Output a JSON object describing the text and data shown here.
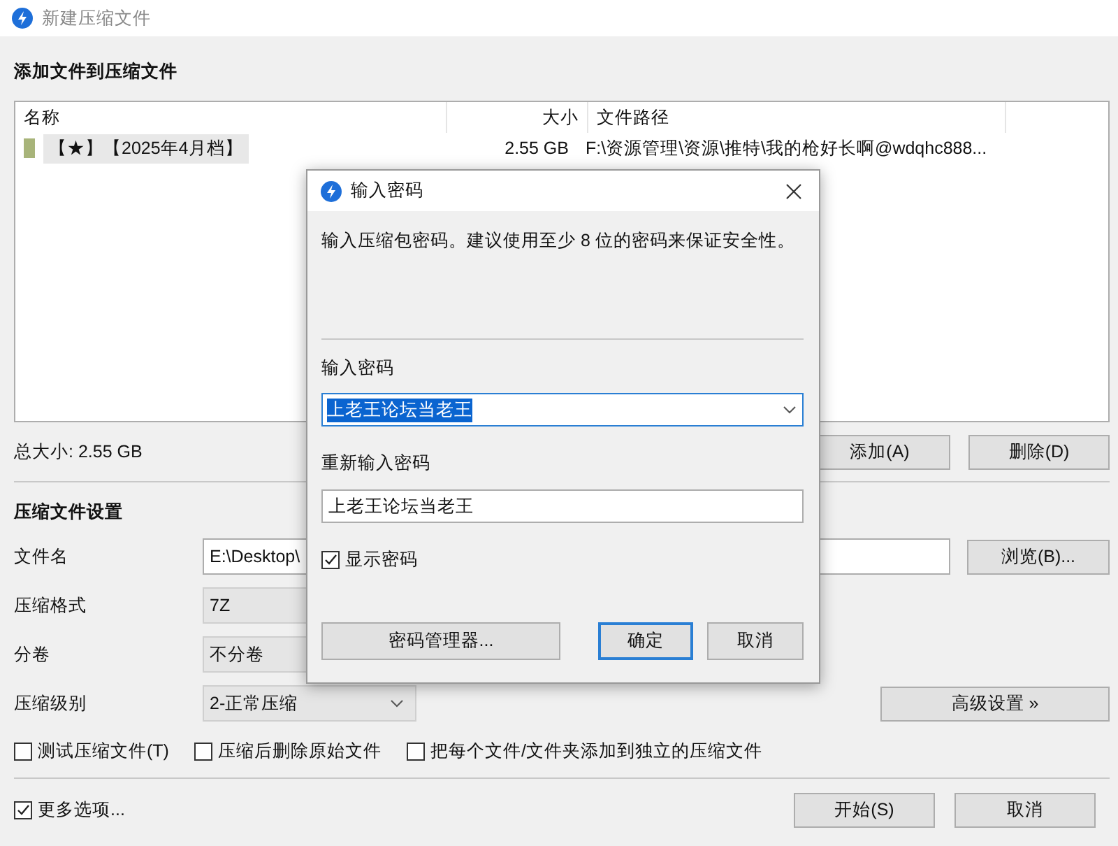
{
  "window": {
    "title": "新建压缩文件"
  },
  "files_section": {
    "heading": "添加文件到压缩文件",
    "columns": [
      "名称",
      "大小",
      "文件路径"
    ],
    "rows": [
      {
        "name": "【★】【2025年4月档】",
        "size": "2.55 GB",
        "path": "F:\\资源管理\\资源\\推特\\我的枪好长啊@wdqhc888...",
        "selected": true
      }
    ],
    "total": "总大小: 2.55 GB",
    "buttons": [
      "添加(A)",
      "删除(D)"
    ]
  },
  "settings": {
    "heading": "压缩文件设置",
    "fields": [
      {
        "kind": "text",
        "label": "文件名",
        "value": "E:\\Desktop\\"
      },
      {
        "kind": "select",
        "label": "压缩格式",
        "value": "7Z"
      },
      {
        "kind": "select",
        "label": "分卷",
        "value": "不分卷"
      },
      {
        "kind": "combo",
        "label": "压缩级别",
        "value": "2-正常压缩"
      }
    ],
    "browse_button": "浏览(B)...",
    "advanced_button": "高级设置 »",
    "options": [
      {
        "label": "测试压缩文件(T)",
        "checked": false
      },
      {
        "label": "压缩后删除原始文件",
        "checked": false
      },
      {
        "label": "把每个文件/文件夹添加到独立的压缩文件",
        "checked": false
      }
    ]
  },
  "footer": {
    "more_options": {
      "label": "更多选项...",
      "checked": true
    },
    "buttons": [
      "开始(S)",
      "取消"
    ]
  },
  "password_dialog": {
    "title": "输入密码",
    "description": "输入压缩包密码。建议使用至少 8 位的密码来保证安全性。",
    "password_label": "输入密码",
    "password": "上老王论坛当老王",
    "password_selected": true,
    "confirm_label": "重新输入密码",
    "confirm": "上老王论坛当老王",
    "show_password": {
      "label": "显示密码",
      "checked": true
    },
    "buttons": [
      {
        "label": "密码管理器...",
        "default": false
      },
      {
        "label": "确定",
        "default": true
      },
      {
        "label": "取消",
        "default": false
      }
    ]
  }
}
